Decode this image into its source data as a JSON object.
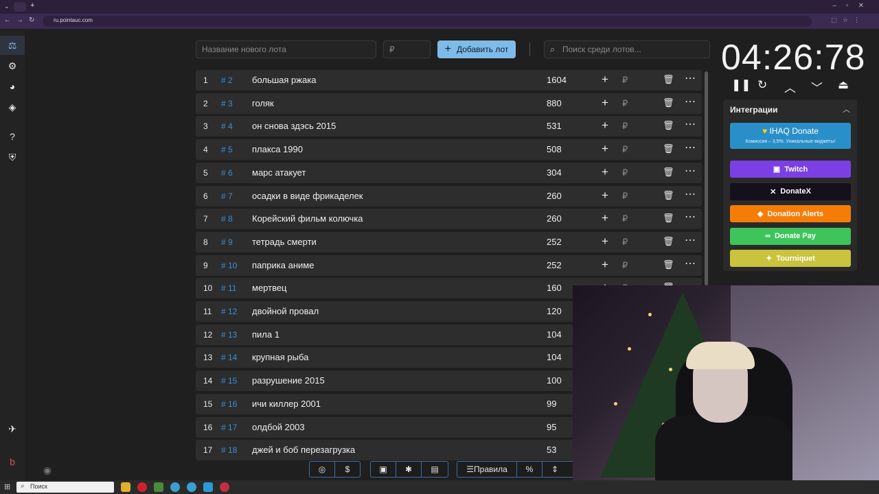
{
  "browser": {
    "url": "ru.pointauc.com"
  },
  "toolbar": {
    "lot_name_placeholder": "Название нового лота",
    "price_placeholder": "₽",
    "add_button_label": "Добавить лот",
    "search_placeholder": "Поиск среди лотов..."
  },
  "lots": [
    {
      "n": "1",
      "id": "# 2",
      "name": "большая ржака",
      "value": "1604"
    },
    {
      "n": "2",
      "id": "# 3",
      "name": "голяк",
      "value": "880"
    },
    {
      "n": "3",
      "id": "# 4",
      "name": "он снова здэсь 2015",
      "value": "531"
    },
    {
      "n": "4",
      "id": "# 5",
      "name": "плакса 1990",
      "value": "508"
    },
    {
      "n": "5",
      "id": "# 6",
      "name": "марс атакует",
      "value": "304"
    },
    {
      "n": "6",
      "id": "# 7",
      "name": "осадки в виде фрикаделек",
      "value": "260"
    },
    {
      "n": "7",
      "id": "# 8",
      "name": "Корейский фильм колючка",
      "value": "260"
    },
    {
      "n": "8",
      "id": "# 9",
      "name": "тетрадь смерти",
      "value": "252"
    },
    {
      "n": "9",
      "id": "# 10",
      "name": "паприка аниме",
      "value": "252"
    },
    {
      "n": "10",
      "id": "# 11",
      "name": "мертвец",
      "value": "160"
    },
    {
      "n": "11",
      "id": "# 12",
      "name": " двойной провал",
      "value": "120"
    },
    {
      "n": "12",
      "id": "# 13",
      "name": "пила 1",
      "value": "104"
    },
    {
      "n": "13",
      "id": "# 14",
      "name": "крупная рыба",
      "value": "104"
    },
    {
      "n": "14",
      "id": "# 15",
      "name": "разрушение 2015",
      "value": "100"
    },
    {
      "n": "15",
      "id": "# 16",
      "name": "ичи киллер 2001",
      "value": "99"
    },
    {
      "n": "16",
      "id": "# 17",
      "name": "олдбой 2003",
      "value": "95"
    },
    {
      "n": "17",
      "id": "# 18",
      "name": "джей и боб перезагрузка",
      "value": "53"
    }
  ],
  "row_symbols": {
    "plus": "+",
    "currency": "₽",
    "delete": "🗑",
    "more": "⋯"
  },
  "timer": {
    "display": "04:26:78"
  },
  "integrations": {
    "title": "Интеграции",
    "ihaq": {
      "label": "IHAQ Donate",
      "subtitle": "Комиссия – 3,5%. Уникальные виджеты!",
      "color": "#2a8fc9"
    },
    "buttons": [
      {
        "label": "Twitch",
        "color": "#7b3fe4"
      },
      {
        "label": "DonateX",
        "color": "#14101c"
      },
      {
        "label": "Donation Alerts",
        "color": "#f57d07"
      },
      {
        "label": "Donate Pay",
        "color": "#3ec45b"
      },
      {
        "label": "Tourniquet",
        "color": "#c9c33e"
      }
    ]
  },
  "bottom_toolbar": {
    "rules_label": "Правила",
    "percent_label": "%"
  },
  "taskbar": {
    "search_label": "Поиск"
  },
  "colors": {
    "accent": "#7fbbe9",
    "id_blue": "#3b8fd6",
    "row_bg": "#2d2d2d",
    "page_bg": "#1f1f1f"
  }
}
